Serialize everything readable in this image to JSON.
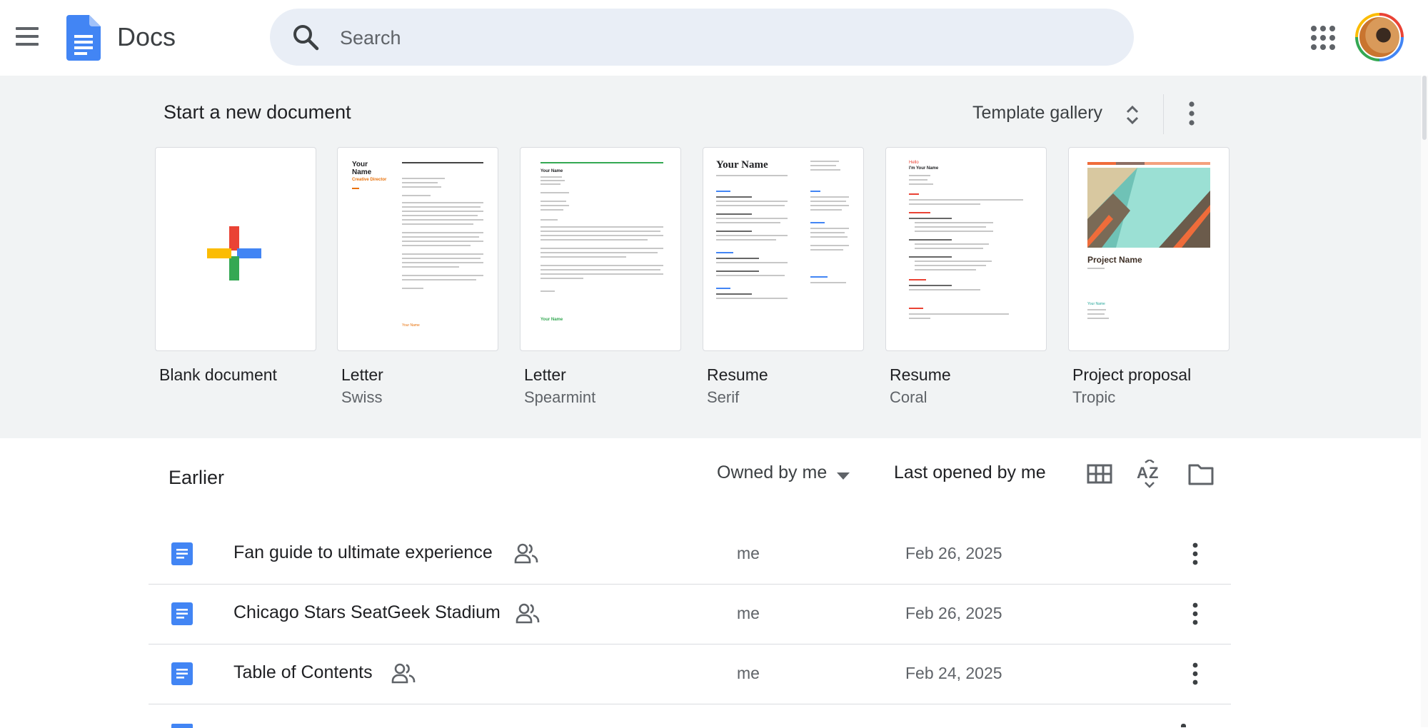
{
  "header": {
    "app_name": "Docs",
    "search_placeholder": "Search"
  },
  "templates": {
    "heading": "Start a new document",
    "gallery_label": "Template gallery",
    "cards": [
      {
        "title": "Blank document",
        "subtitle": ""
      },
      {
        "title": "Letter",
        "subtitle": "Swiss"
      },
      {
        "title": "Letter",
        "subtitle": "Spearmint"
      },
      {
        "title": "Resume",
        "subtitle": "Serif"
      },
      {
        "title": "Resume",
        "subtitle": "Coral"
      },
      {
        "title": "Project proposal",
        "subtitle": "Tropic"
      }
    ],
    "thumb_text": {
      "swiss_name": "Your Name",
      "swiss_role": "Creative Director",
      "swiss_sign": "Your Name",
      "spearmint_name": "Your Name",
      "spearmint_sign": "Your Name",
      "serif_name": "Your Name",
      "coral_hello": "Hello",
      "coral_name": "I'm Your Name",
      "tropic_title": "Project Name",
      "tropic_name": "Your Name"
    }
  },
  "list": {
    "heading": "Earlier",
    "owner_filter": "Owned by me",
    "sort_label": "Last opened by me",
    "rows": [
      {
        "title": "Fan guide to ultimate experience",
        "owner": "me",
        "date": "Feb 26, 2025"
      },
      {
        "title": "Chicago Stars SeatGeek Stadium",
        "owner": "me",
        "date": "Feb 26, 2025"
      },
      {
        "title": "Table of Contents",
        "owner": "me",
        "date": "Feb 24, 2025"
      }
    ]
  },
  "colors": {
    "docs_blue": "#4285f4",
    "search_bg": "#e9eef6",
    "template_bg": "#f1f3f4"
  }
}
